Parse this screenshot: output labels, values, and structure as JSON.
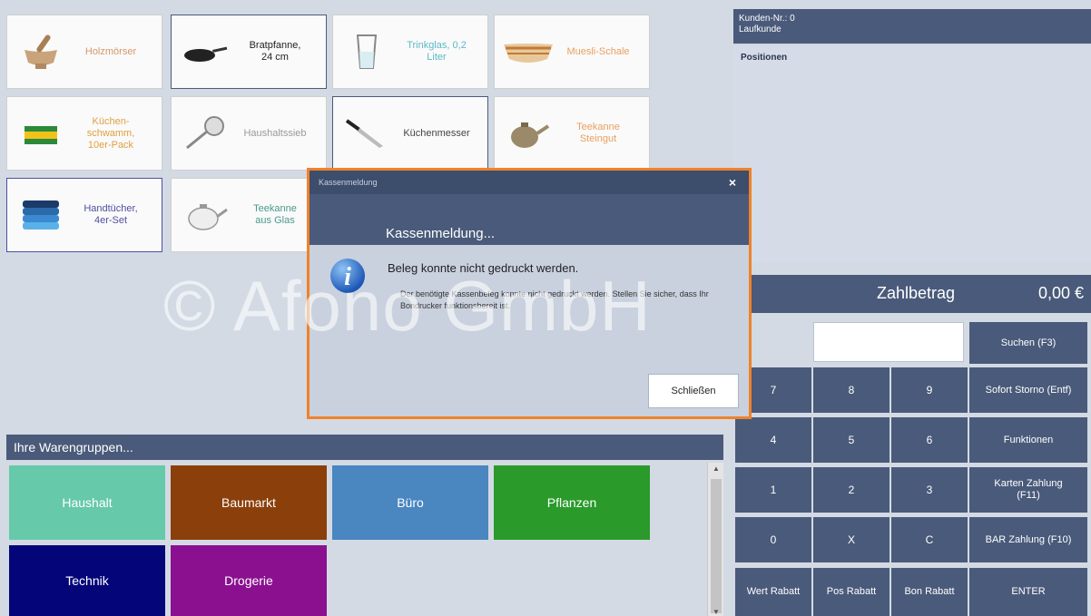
{
  "products": [
    {
      "name": "Holzmörser",
      "icon": "mortar-icon",
      "color": "#d4976a",
      "border": "#cfcfcf"
    },
    {
      "name": "Bratpfanne,\n24 cm",
      "icon": "frying-pan-icon",
      "color": "#222222",
      "border": "#4a5a7a"
    },
    {
      "name": "Trinkglas, 0,2\nLiter",
      "icon": "glass-icon",
      "color": "#5bb9c9",
      "border": "#cfcfcf"
    },
    {
      "name": "Muesli-Schale",
      "icon": "bowl-icon",
      "color": "#e8a060",
      "border": "#cfcfcf"
    },
    {
      "name": "Küchen-\nschwamm,\n10er-Pack",
      "icon": "sponge-icon",
      "color": "#e0a040",
      "border": "#cfcfcf"
    },
    {
      "name": "Haushaltssieb",
      "icon": "sieve-icon",
      "color": "#999999",
      "border": "#cfcfcf"
    },
    {
      "name": "Küchenmesser",
      "icon": "knife-icon",
      "color": "#444444",
      "border": "#4a5a7a"
    },
    {
      "name": "Teekanne\nSteingut",
      "icon": "teapot-icon",
      "color": "#e8a060",
      "border": "#cfcfcf"
    },
    {
      "name": "Handtücher,\n4er-Set",
      "icon": "towels-icon",
      "color": "#5050a0",
      "border": "#5050a0"
    },
    {
      "name": "Teekanne\naus Glas",
      "icon": "glass-teapot-icon",
      "color": "#4a9a8a",
      "border": "#cfcfcf"
    }
  ],
  "warengruppen": {
    "header": "Ihre Warengruppen...",
    "groups": [
      {
        "label": "Haushalt",
        "color": "#66c9a9"
      },
      {
        "label": "Baumarkt",
        "color": "#8b3f0a"
      },
      {
        "label": "Büro",
        "color": "#4a86c0"
      },
      {
        "label": "Pflanzen",
        "color": "#2a9a2a"
      },
      {
        "label": "Technik",
        "color": "#05057a"
      },
      {
        "label": "Drogerie",
        "color": "#8a1090"
      }
    ]
  },
  "customer": {
    "number": "Kunden-Nr.: 0",
    "type": "Laufkunde"
  },
  "positions_label": "Positionen",
  "total": {
    "label": "Zahlbetrag",
    "value": "0,00 €"
  },
  "keys": {
    "suchen": "Suchen (F3)",
    "storno": "Sofort Storno (Entf)",
    "funktionen": "Funktionen",
    "karte": "Karten Zahlung\n(F11)",
    "bar": "BAR Zahlung (F10)",
    "enter": "ENTER",
    "n7": "7",
    "n8": "8",
    "n9": "9",
    "n4": "4",
    "n5": "5",
    "n6": "6",
    "n1": "1",
    "n2": "2",
    "n3": "3",
    "n0": "0",
    "x": "X",
    "c": "C",
    "wert": "Wert Rabatt",
    "pos": "Pos Rabatt",
    "bon": "Bon Rabatt"
  },
  "dialog": {
    "title": "Kassenmeldung",
    "close": "×",
    "heading": "Kassenmeldung...",
    "message": "Beleg konnte nicht gedruckt werden.",
    "detail": "Der benötigte Kassenbeleg konnte nicht gedruckt werden. Stellen Sie sicher, dass Ihr Bondrucker funktionsbereit ist.",
    "button": "Schließen"
  },
  "watermark": "© Afono GmbH"
}
